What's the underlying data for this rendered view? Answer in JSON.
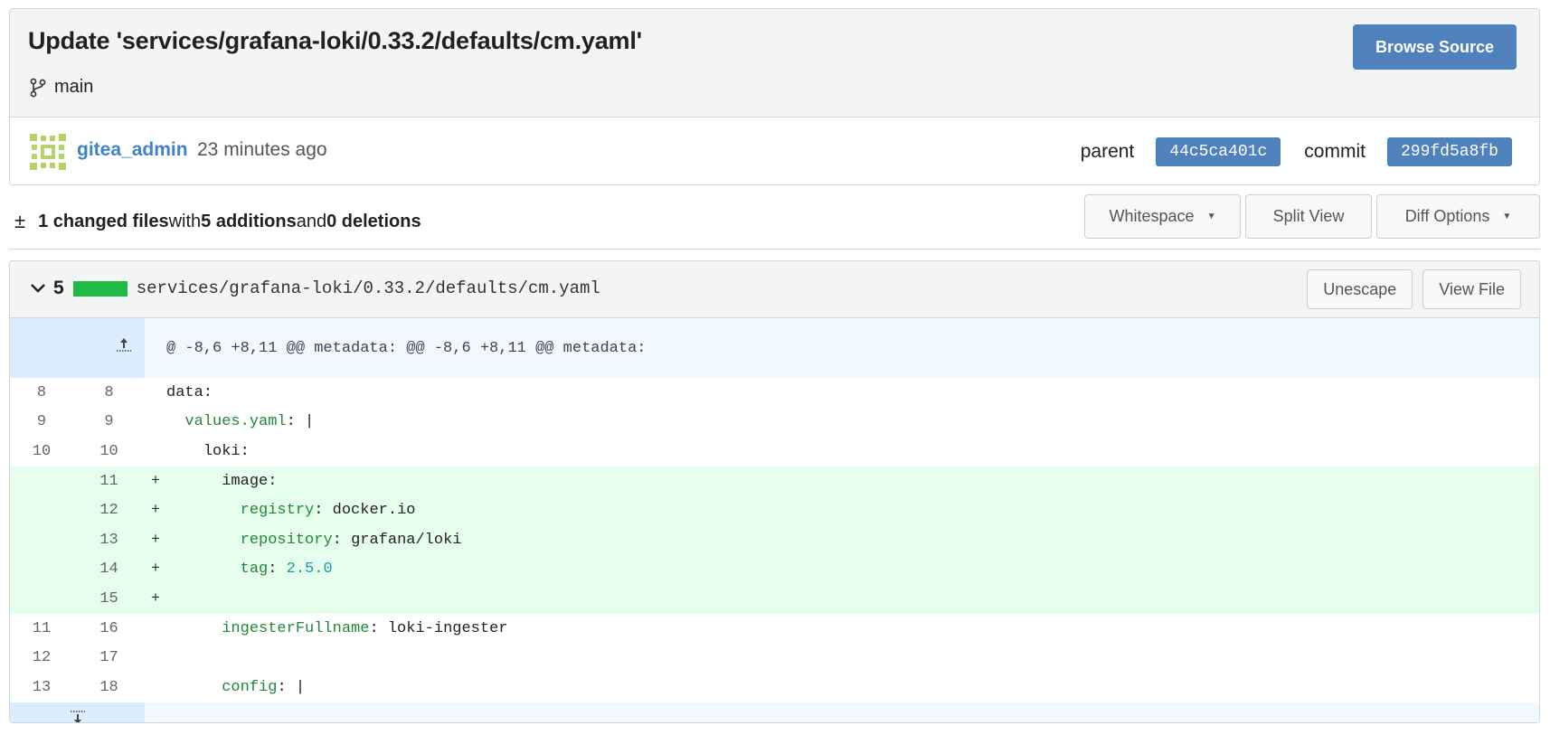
{
  "commit": {
    "title": "Update 'services/grafana-loki/0.33.2/defaults/cm.yaml'",
    "branch": "main",
    "browse_label": "Browse Source",
    "author": "gitea_admin",
    "time": "23 minutes ago",
    "parent_label": "parent",
    "parent_sha": "44c5ca401c",
    "commit_label": "commit",
    "commit_sha": "299fd5a8fb"
  },
  "stats": {
    "icon": "plus-minus-icon",
    "changed": "1 changed files",
    "with": " with ",
    "additions": "5 additions",
    "and": " and ",
    "deletions": "0 deletions",
    "whitespace_label": "Whitespace",
    "split_label": "Split View",
    "options_label": "Diff Options"
  },
  "file": {
    "count": "5",
    "path": "services/grafana-loki/0.33.2/defaults/cm.yaml",
    "unescape_label": "Unescape",
    "view_label": "View File",
    "hunk": "@ -8,6 +8,11 @@ metadata: @@ -8,6 +8,11 @@ metadata:",
    "lines": [
      {
        "type": "ctx",
        "old": "8",
        "new": "8",
        "mark": "",
        "indent": "",
        "key": "",
        "sep": "",
        "text": "data:",
        "val": ""
      },
      {
        "type": "ctx",
        "old": "9",
        "new": "9",
        "mark": "",
        "indent": "  ",
        "key": "values.yaml",
        "sep": ": ",
        "text": "|",
        "val": ""
      },
      {
        "type": "ctx",
        "old": "10",
        "new": "10",
        "mark": "",
        "indent": "    ",
        "key": "",
        "sep": "",
        "text": "loki:",
        "val": ""
      },
      {
        "type": "add",
        "old": "",
        "new": "11",
        "mark": "+",
        "indent": "      ",
        "key": "",
        "sep": "",
        "text": "image:",
        "val": ""
      },
      {
        "type": "add",
        "old": "",
        "new": "12",
        "mark": "+",
        "indent": "        ",
        "key": "registry",
        "sep": ": ",
        "text": "docker.io",
        "val": ""
      },
      {
        "type": "add",
        "old": "",
        "new": "13",
        "mark": "+",
        "indent": "        ",
        "key": "repository",
        "sep": ": ",
        "text": "grafana/loki",
        "val": ""
      },
      {
        "type": "add",
        "old": "",
        "new": "14",
        "mark": "+",
        "indent": "        ",
        "key": "tag",
        "sep": ": ",
        "text": "",
        "val": "2.5.0"
      },
      {
        "type": "add",
        "old": "",
        "new": "15",
        "mark": "+",
        "indent": "",
        "key": "",
        "sep": "",
        "text": "",
        "val": ""
      },
      {
        "type": "ctx",
        "old": "11",
        "new": "16",
        "mark": "",
        "indent": "      ",
        "key": "ingesterFullname",
        "sep": ": ",
        "text": "loki-ingester",
        "val": ""
      },
      {
        "type": "ctx",
        "old": "12",
        "new": "17",
        "mark": "",
        "indent": "",
        "key": "",
        "sep": "",
        "text": "",
        "val": ""
      },
      {
        "type": "ctx",
        "old": "13",
        "new": "18",
        "mark": "",
        "indent": "      ",
        "key": "config",
        "sep": ": ",
        "text": "|",
        "val": ""
      }
    ]
  },
  "colors": {
    "primary": "#4f81bd",
    "add_bg": "#e6ffed",
    "hunk_bg": "#f1f8ff",
    "bar_green": "#21ba45"
  }
}
